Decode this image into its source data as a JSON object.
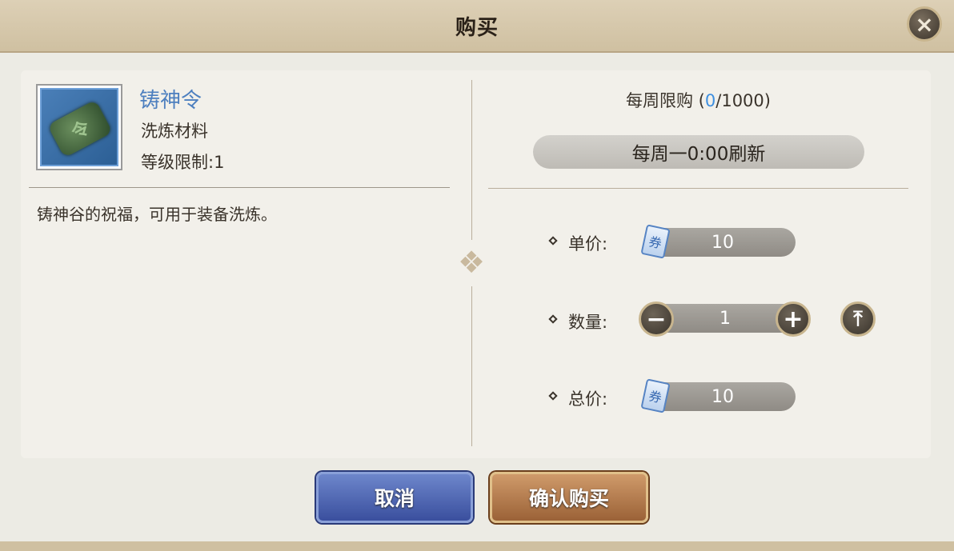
{
  "dialog": {
    "title": "购买",
    "close_icon": "×"
  },
  "item": {
    "name": "铸神令",
    "type": "洗炼材料",
    "level_text": "等级限制:1",
    "description": "铸神谷的祝福，可用于装备洗炼。",
    "icon_glyph": "令"
  },
  "limit": {
    "label": "每周限购",
    "current": "0",
    "max": "1000"
  },
  "refresh": {
    "text": "每周一0:00刷新"
  },
  "unit_price": {
    "label": "单价:",
    "value": "10"
  },
  "quantity": {
    "label": "数量:",
    "value": "1",
    "minus": "−",
    "plus": "+",
    "max": "⤒"
  },
  "total": {
    "label": "总价:",
    "value": "10"
  },
  "currency_glyph": "券",
  "buttons": {
    "cancel": "取消",
    "confirm": "确认购买"
  },
  "colors": {
    "name_blue": "#4d7fbf",
    "limit_current_blue": "#3d8fe0",
    "cancel_blue": "#3a4f9e",
    "confirm_brown": "#9b6237"
  }
}
